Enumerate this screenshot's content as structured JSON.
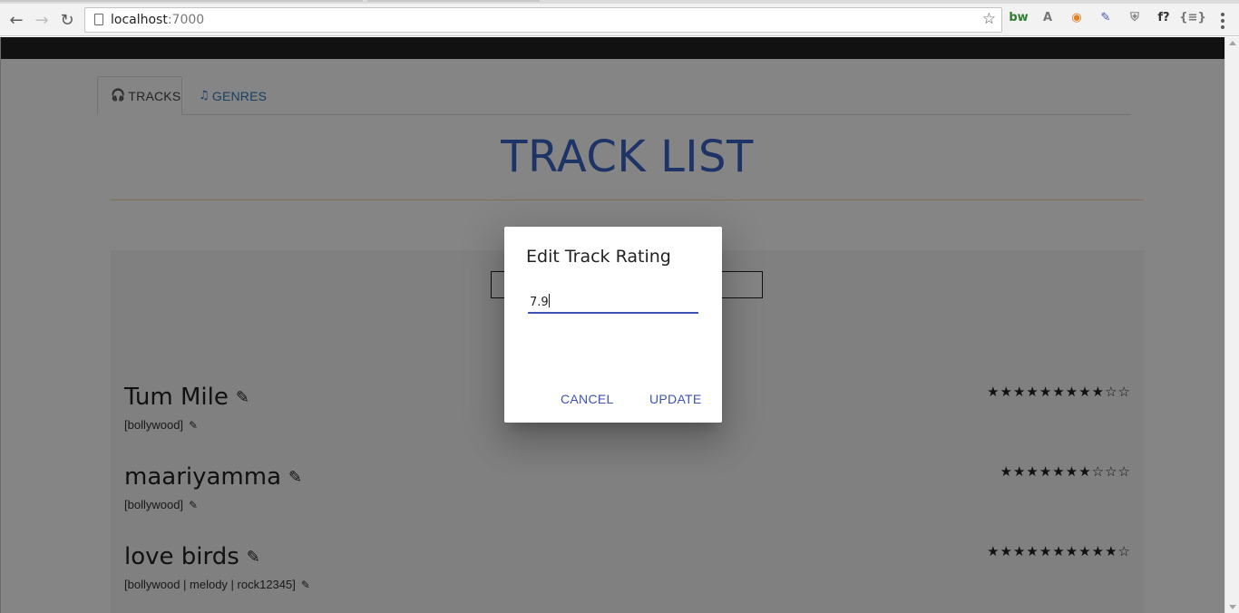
{
  "browser": {
    "url_host": "localhost",
    "url_port": ":7000",
    "extensions": [
      {
        "name": "bw-extension-icon",
        "glyph": "bw",
        "color": "#2e7d32"
      },
      {
        "name": "angular-extension-icon",
        "glyph": "A",
        "color": "#777777"
      },
      {
        "name": "eye-extension-icon",
        "glyph": "◉",
        "color": "#e67e22"
      },
      {
        "name": "color-picker-extension-icon",
        "glyph": "✎",
        "color": "#3f51b5"
      },
      {
        "name": "shield-extension-icon",
        "glyph": "⛨",
        "color": "#888888"
      },
      {
        "name": "function-extension-icon",
        "glyph": "f?",
        "color": "#333333"
      },
      {
        "name": "json-extension-icon",
        "glyph": "{≡}",
        "color": "#777777"
      }
    ]
  },
  "tabs": [
    {
      "label": "TRACKS",
      "icon": "headphones-icon",
      "active": true
    },
    {
      "label": "GENRES",
      "icon": "music-note-icon",
      "active": false
    }
  ],
  "page": {
    "title": "TRACK LIST"
  },
  "tracks": [
    {
      "name": "Tum Mile",
      "genres": "[bollywood]",
      "rating": 9,
      "max_rating": 10,
      "stars": "★★★★★★★★★☆☆"
    },
    {
      "name": "maariyamma",
      "genres": "[bollywood]",
      "rating": 7.5,
      "max_rating": 10,
      "stars": "★★★★★★★☆☆☆"
    },
    {
      "name": "love birds",
      "genres": "[bollywood | melody | rock12345]",
      "rating": 9.5,
      "max_rating": 10,
      "stars": "★★★★★★★★★★☆"
    }
  ],
  "dialog": {
    "title": "Edit Track Rating",
    "input_value": "7.9",
    "cancel_label": "CANCEL",
    "update_label": "UPDATE"
  },
  "colors": {
    "accent": "#3f51b5",
    "title_blue": "#3b63c4",
    "link_blue": "#337ab7",
    "app_bar": "#222222"
  }
}
